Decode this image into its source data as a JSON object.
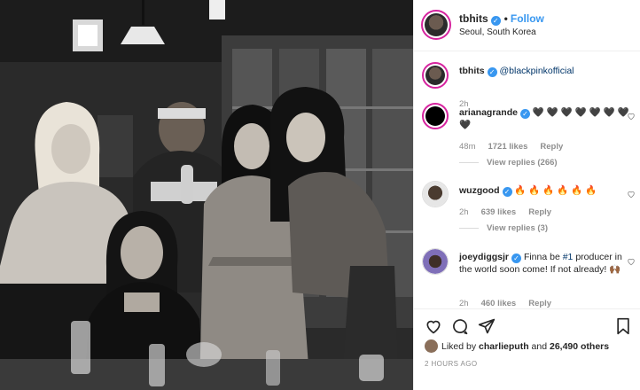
{
  "header": {
    "username": "tbhits",
    "dot": "•",
    "follow_label": "Follow",
    "location": "Seoul, South Korea"
  },
  "caption": {
    "username": "tbhits",
    "mention": "@blackpinkofficial",
    "time": "2h"
  },
  "comments": [
    {
      "username": "arianagrande",
      "text": "🖤 🖤 🖤 🖤 🖤 🖤 🖤 🖤",
      "time": "48m",
      "likes": "1721 likes",
      "reply_label": "Reply",
      "view_replies": "View replies (266)"
    },
    {
      "username": "wuzgood",
      "text": "🔥 🔥 🔥 🔥 🔥 🔥",
      "time": "2h",
      "likes": "639 likes",
      "reply_label": "Reply",
      "view_replies": "View replies (3)"
    },
    {
      "username": "joeydiggsjr",
      "text_before": "Finna be ",
      "text_link": "#1",
      "text_after": " producer in the world soon come! If not already! 🙌🏾",
      "time": "2h",
      "likes": "460 likes",
      "reply_label": "Reply"
    }
  ],
  "likes": {
    "liked_by": "Liked by ",
    "user": "charlieputh",
    "and_label": " and ",
    "others": "26,490 others"
  },
  "timestamp": "2 HOURS AGO",
  "icons": {
    "verified": "verified-badge-icon",
    "heart": "heart-icon",
    "comment": "comment-icon",
    "share": "share-icon",
    "save": "bookmark-icon"
  },
  "colors": {
    "accent": "#3897f0",
    "ring": "#d6249f",
    "muted": "#8e8e8e"
  }
}
